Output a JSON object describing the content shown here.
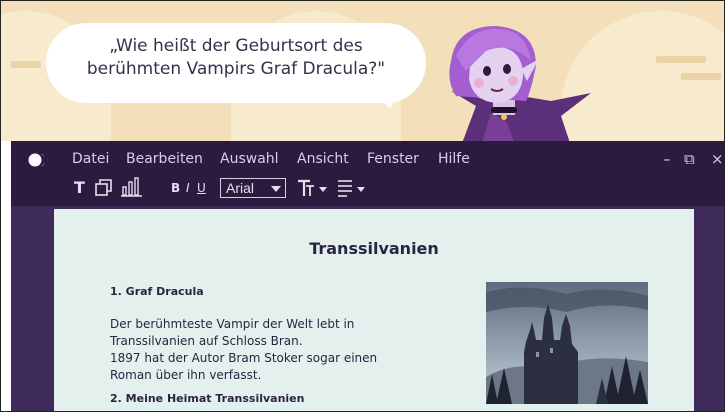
{
  "speech": {
    "line1": "„Wie heißt der Geburtsort des",
    "line2": "berühmten Vampirs Graf Dracula?\""
  },
  "menu": {
    "items": [
      "Datei",
      "Bearbeiten",
      "Auswahl",
      "Ansicht",
      "Fenster",
      "Hilfe"
    ]
  },
  "window": {
    "minimize": "–",
    "restore": "⧉",
    "close": "×"
  },
  "toolbar": {
    "text_tool": "T",
    "bold": "B",
    "italic": "I",
    "underline": "U",
    "font": "Arial"
  },
  "document": {
    "title": "Transsilvanien",
    "section1_heading": "1. Graf Dracula",
    "section1_lines": [
      "Der berühmteste Vampir der Welt lebt in",
      "Transsilvanien auf Schloss Bran.",
      "1897 hat der Autor Bram Stoker sogar einen",
      "Roman über ihn verfasst."
    ],
    "section2_heading": "2. Meine Heimat Transsilvanien"
  },
  "colors": {
    "banner": "#f3dfba",
    "titlebar": "#2a1b3f",
    "app_bg": "#3e2a5b",
    "page": "#e4f0ee",
    "text": "#2a2440"
  }
}
